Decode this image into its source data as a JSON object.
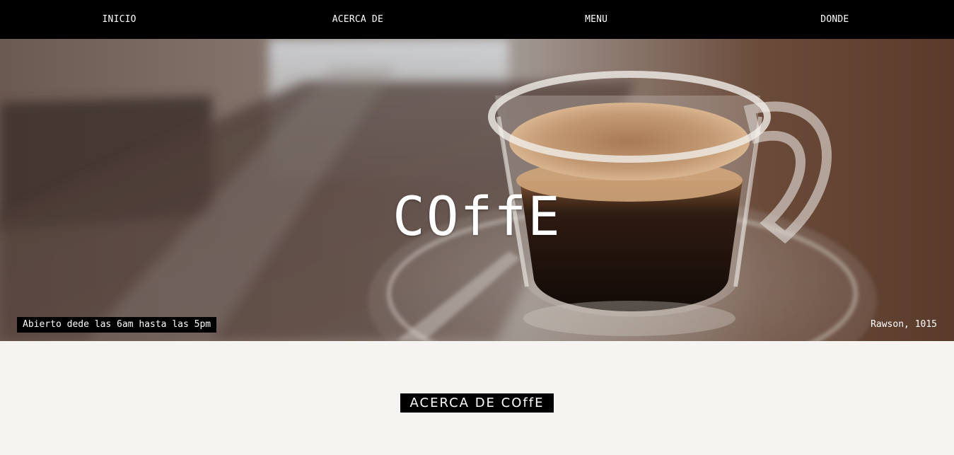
{
  "nav": {
    "items": [
      {
        "label": "INICIO"
      },
      {
        "label": "ACERCA DE"
      },
      {
        "label": "MENU"
      },
      {
        "label": "DONDE"
      }
    ]
  },
  "hero": {
    "title": "COffE",
    "hours": "Abierto dede las 6am hasta las 5pm",
    "address": "Rawson, 1015",
    "image": "espresso-cup-photo"
  },
  "about": {
    "heading": "ACERCA DE COffE"
  },
  "colors": {
    "navbar": "#000000",
    "page_background": "#f5f4f0",
    "badge": "#000000",
    "text_light": "#ffffff"
  }
}
